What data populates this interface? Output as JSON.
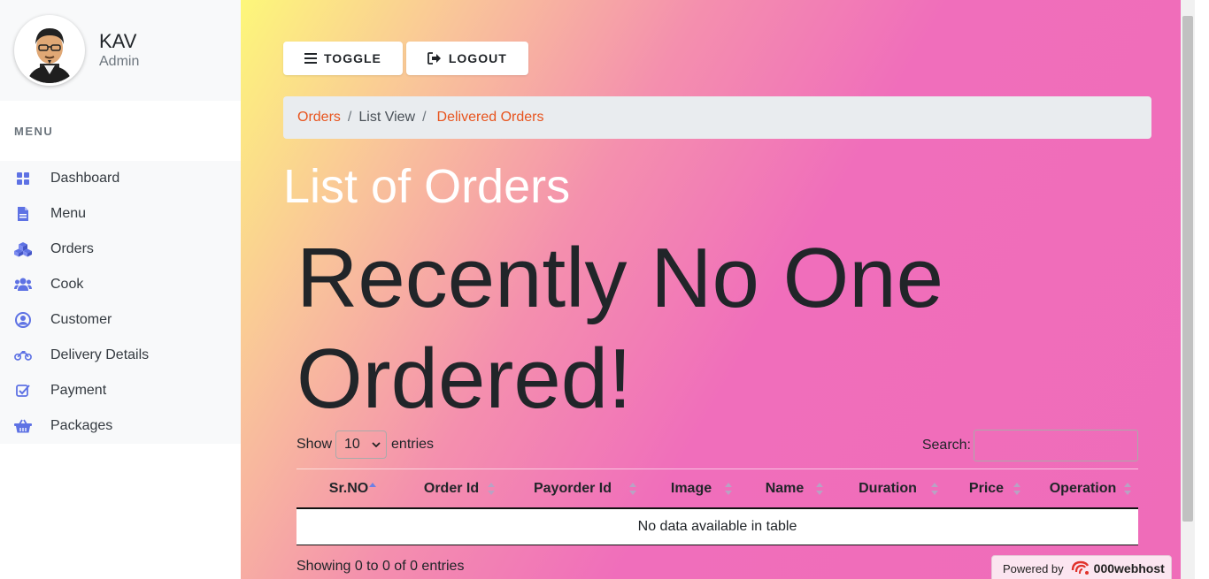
{
  "profile": {
    "name": "KAV",
    "role": "Admin"
  },
  "menu": {
    "heading": "MENU",
    "items": [
      {
        "label": "Dashboard",
        "icon": "dashboard-icon"
      },
      {
        "label": "Menu",
        "icon": "file-icon"
      },
      {
        "label": "Orders",
        "icon": "cubes-icon"
      },
      {
        "label": "Cook",
        "icon": "users-icon"
      },
      {
        "label": "Customer",
        "icon": "user-circle-icon"
      },
      {
        "label": "Delivery Details",
        "icon": "motorcycle-icon"
      },
      {
        "label": "Payment",
        "icon": "check-square-icon"
      },
      {
        "label": "Packages",
        "icon": "basket-icon"
      }
    ]
  },
  "toolbar": {
    "toggle_label": "TOGGLE",
    "logout_label": "LOGOUT"
  },
  "breadcrumb": {
    "item1": "Orders",
    "item2": "List View",
    "item3": "Delivered Orders"
  },
  "page": {
    "title": "List of Orders",
    "message": "Recently No One Ordered!"
  },
  "table_controls": {
    "show_label": "Show",
    "page_size": "10",
    "entries_label": "entries",
    "search_label": "Search:"
  },
  "table": {
    "columns": [
      "Sr.NO",
      "Order Id",
      "Payorder Id",
      "Image",
      "Name",
      "Duration",
      "Price",
      "Operation"
    ],
    "empty_message": "No data available in table",
    "info": "Showing 0 to 0 of 0 entries"
  },
  "footer_badge": {
    "powered_label": "Powered by",
    "brand": "000webhost"
  },
  "colors": {
    "accent": "#e8541e",
    "icon": "#5e72e4",
    "gradient_start": "#fdf77a",
    "gradient_end": "#ef6cb9"
  }
}
